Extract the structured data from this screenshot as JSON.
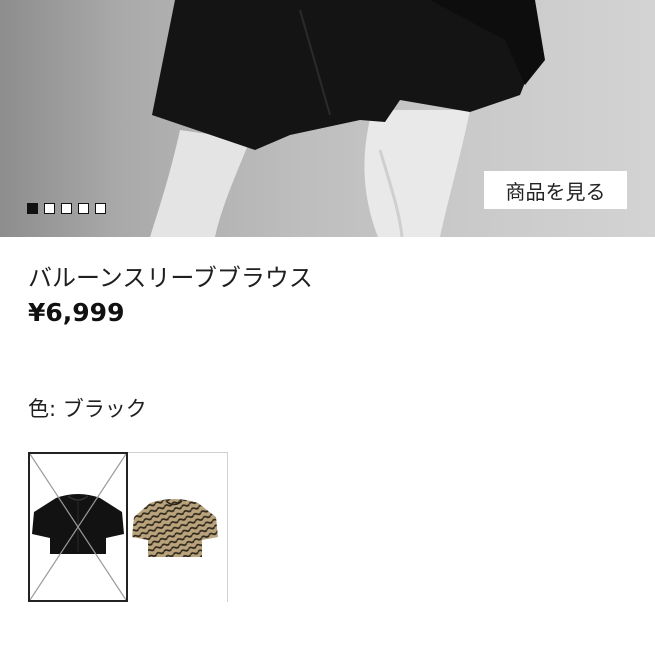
{
  "product": {
    "view_button_label": "商品を見る",
    "name": "バルーンスリーブブラウス",
    "price": "¥6,999",
    "color_label": "色:",
    "color_value": "ブラック",
    "carousel": {
      "count": 5,
      "active_index": 0
    },
    "swatches": [
      {
        "name": "black",
        "selected": true,
        "unavailable": true
      },
      {
        "name": "zebra-beige",
        "selected": false,
        "unavailable": false
      }
    ]
  },
  "colors": {
    "accent": "#111111",
    "background": "#ffffff"
  }
}
